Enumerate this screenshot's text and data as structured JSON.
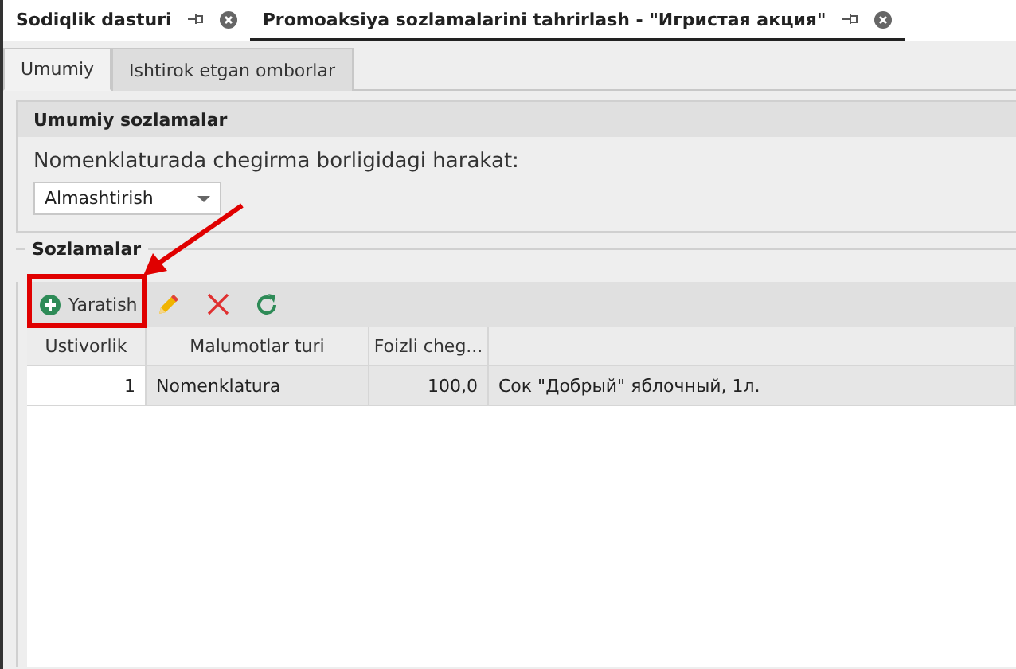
{
  "doc_tabs": [
    {
      "title": "Sodiqlik dasturi",
      "selected": false
    },
    {
      "title": "Promoaksiya sozlamalarini tahrirlash - \"Игристая акция\"",
      "selected": true
    }
  ],
  "tabs": [
    {
      "label": "Umumiy",
      "selected": true
    },
    {
      "label": "Ishtirok etgan omborlar",
      "selected": false
    }
  ],
  "general": {
    "title": "Umumiy sozlamalar",
    "label": "Nomenklaturada chegirma borligidagi harakat:",
    "dropdown": {
      "value": "Almashtirish"
    }
  },
  "settings": {
    "title": "Sozlamalar",
    "toolbar": {
      "create": "Yaratish"
    },
    "table": {
      "columns": [
        "Ustivorlik",
        "Malumotlar turi",
        "Foizli cheg...",
        ""
      ],
      "rows": [
        {
          "cells": [
            "1",
            "Nomenklatura",
            "100,0",
            "Сок \"Добрый\" яблочный, 1л."
          ],
          "selected": true
        }
      ]
    }
  },
  "annotation": {
    "highlight": true
  }
}
